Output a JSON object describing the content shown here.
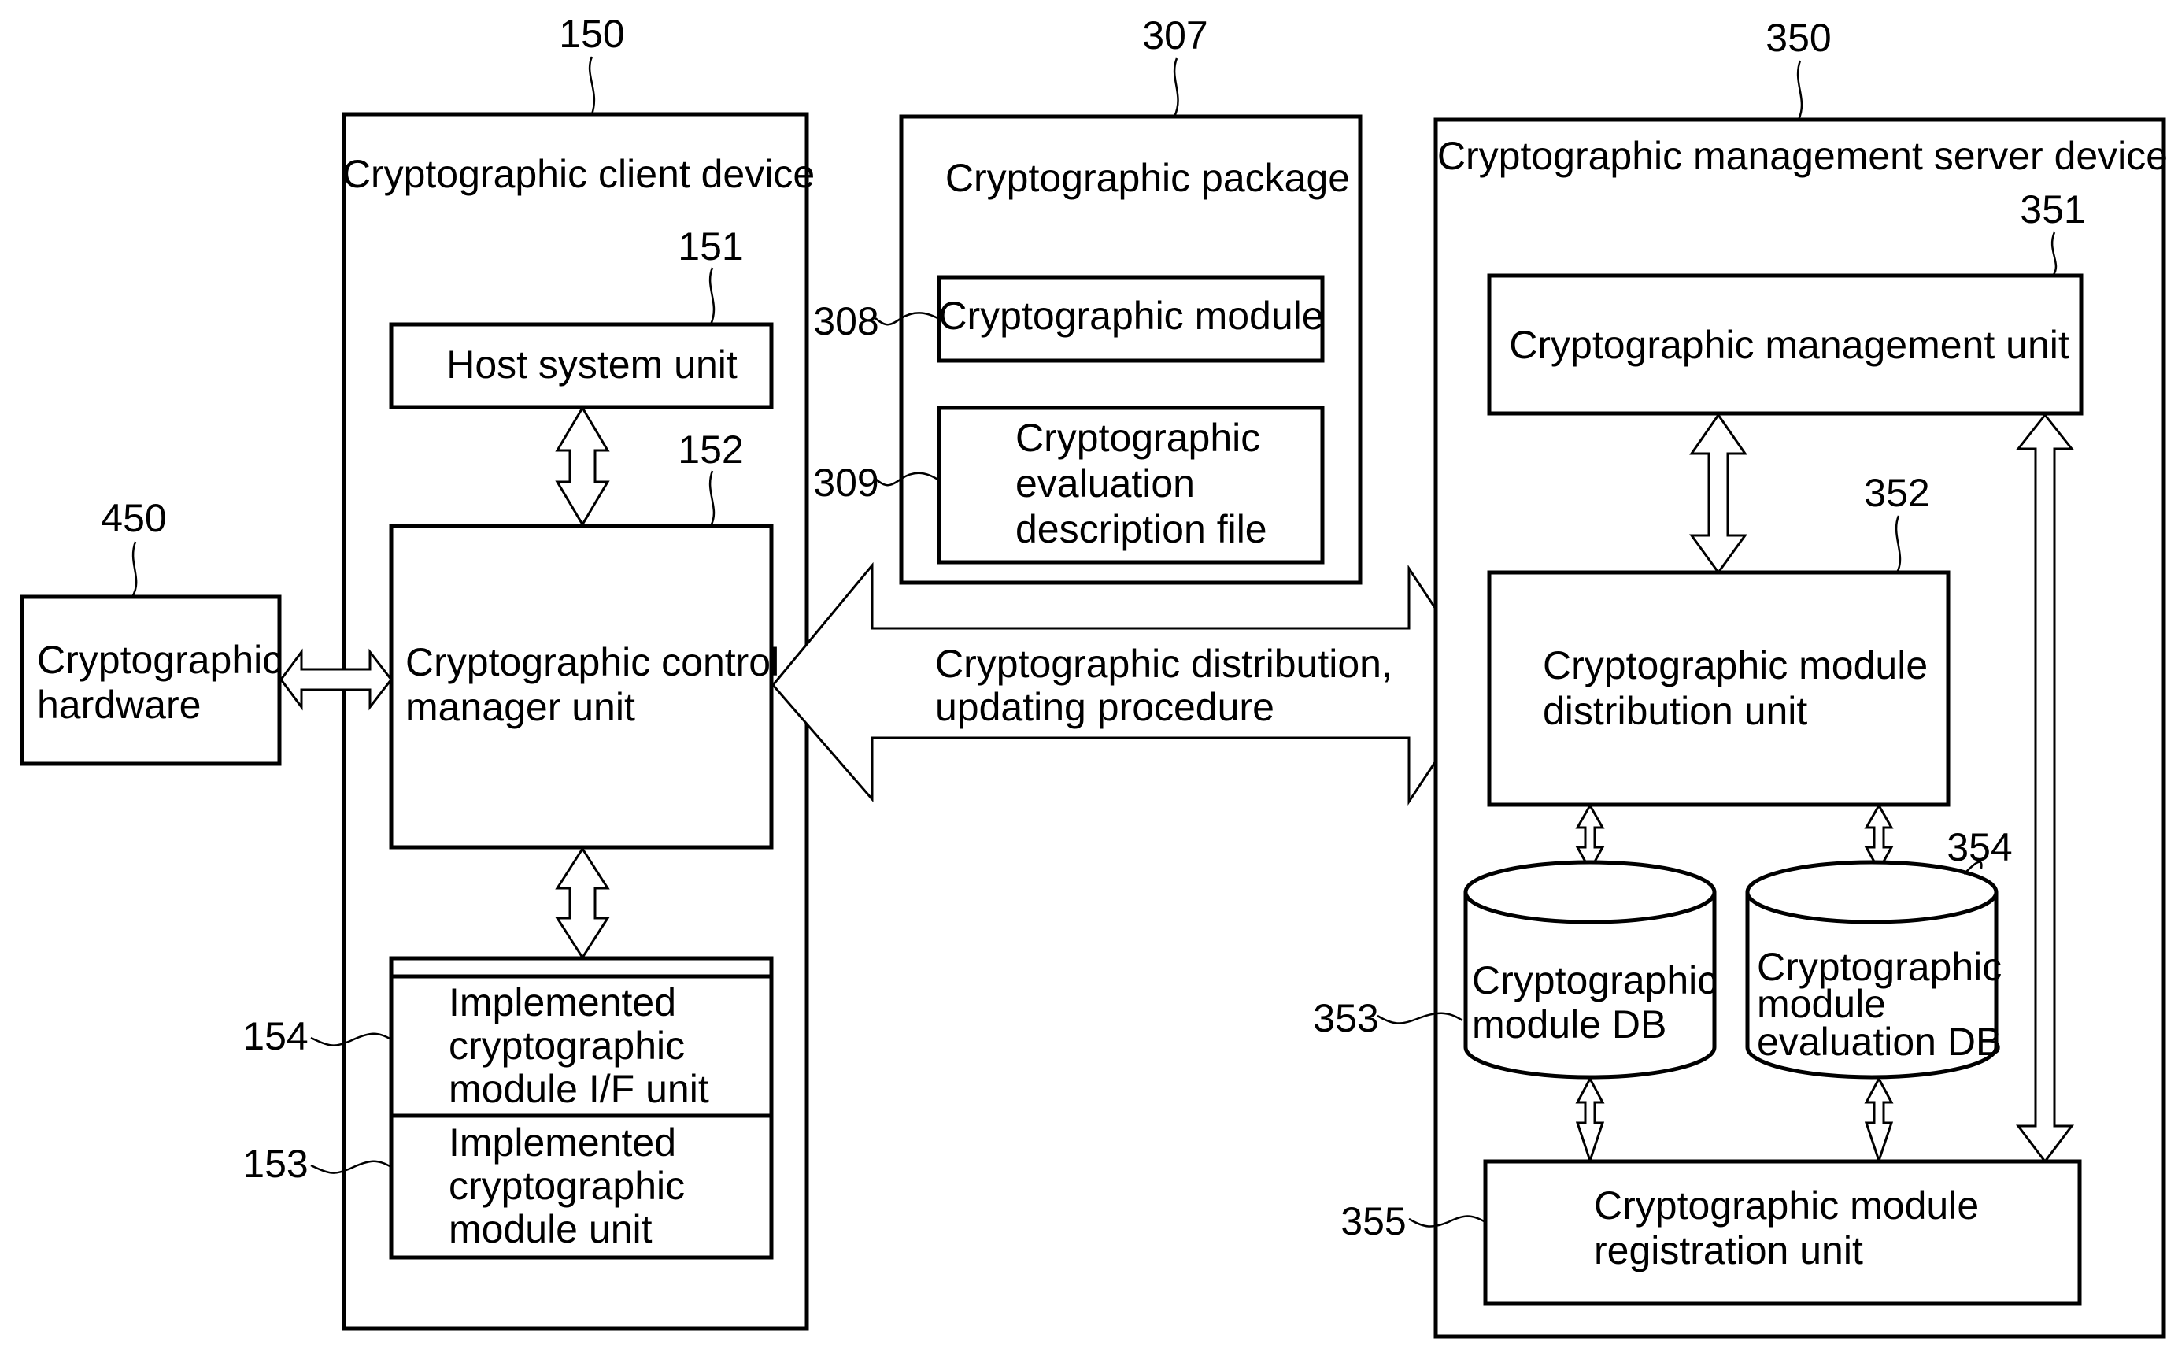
{
  "figure": {
    "client_device": {
      "ref": "150",
      "title": "Cryptographic client device",
      "host_system": {
        "ref": "151",
        "label": "Host system unit"
      },
      "control_manager": {
        "ref": "152",
        "lines": [
          "Cryptographic control",
          "manager unit"
        ]
      },
      "module_if": {
        "ref": "154",
        "lines": [
          "Implemented",
          "cryptographic",
          "module I/F unit"
        ]
      },
      "module_unit": {
        "ref": "153",
        "lines": [
          "Implemented",
          "cryptographic",
          "module unit"
        ]
      }
    },
    "hardware": {
      "ref": "450",
      "lines": [
        "Cryptographic",
        "hardware"
      ]
    },
    "package": {
      "ref": "307",
      "title": "Cryptographic package",
      "module": {
        "ref": "308",
        "label": "Cryptographic module"
      },
      "evaluation_file": {
        "ref": "309",
        "lines": [
          "Cryptographic",
          "evaluation",
          "description file"
        ]
      }
    },
    "distribution_arrow": {
      "lines": [
        "Cryptographic distribution,",
        "updating procedure"
      ]
    },
    "server_device": {
      "ref": "350",
      "title": "Cryptographic management server device",
      "management_unit": {
        "ref": "351",
        "label": "Cryptographic management unit"
      },
      "distribution_unit": {
        "ref": "352",
        "lines": [
          "Cryptographic module",
          "distribution unit"
        ]
      },
      "module_db": {
        "ref": "353",
        "lines": [
          "Cryptographic",
          "module DB"
        ]
      },
      "evaluation_db": {
        "ref": "354",
        "lines": [
          "Cryptographic",
          "module",
          "evaluation DB"
        ]
      },
      "registration_unit": {
        "ref": "355",
        "lines": [
          "Cryptographic module",
          "registration unit"
        ]
      }
    }
  }
}
